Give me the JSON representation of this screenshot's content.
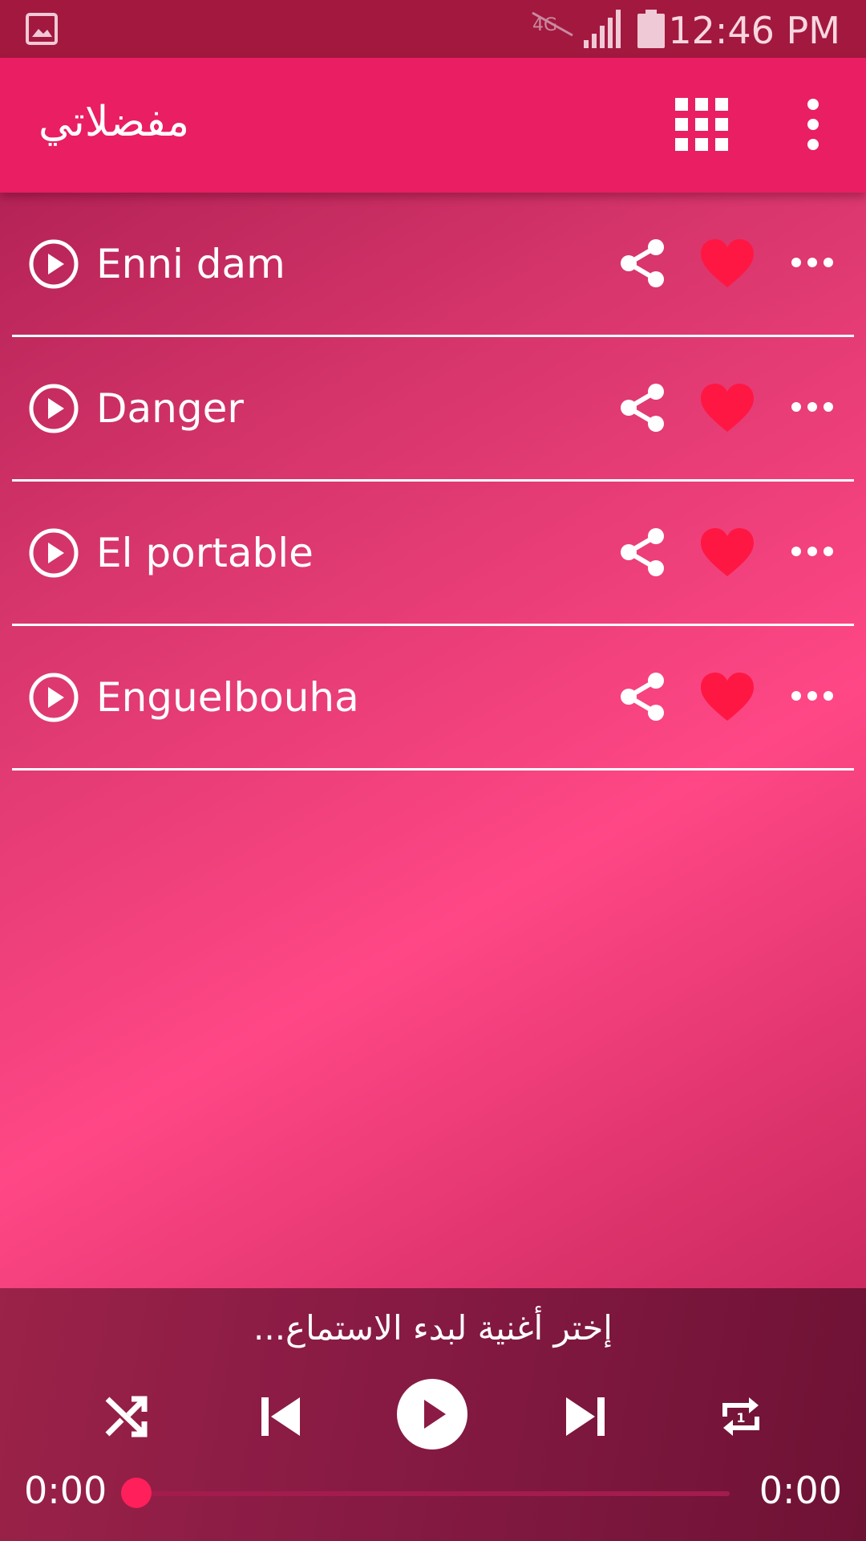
{
  "status_bar": {
    "time": "12:46 PM",
    "icons": [
      "gallery-icon",
      "no-4g-icon",
      "signal-icon",
      "battery-icon"
    ]
  },
  "app_bar": {
    "title": "مفضلاتي",
    "icons": [
      "grid-icon",
      "more-vertical-icon"
    ]
  },
  "songs": [
    {
      "title": "Enni dam"
    },
    {
      "title": "Danger"
    },
    {
      "title": "El portable"
    },
    {
      "title": "Enguelbouha"
    }
  ],
  "row_icons": [
    "play-circle-icon",
    "share-icon",
    "heart-icon",
    "more-horizontal-icon"
  ],
  "player": {
    "prompt": "إختر أغنية لبدء الاستماع...",
    "current_time": "0:00",
    "total_time": "0:00",
    "progress": 0,
    "controls": [
      "shuffle-icon",
      "skip-previous-icon",
      "play-icon",
      "skip-next-icon",
      "repeat-one-icon"
    ]
  },
  "colors": {
    "app_bar": "#e91e63",
    "status_bar": "#a3183f",
    "heart": "#ff1744",
    "player_bg": "#861a43"
  }
}
